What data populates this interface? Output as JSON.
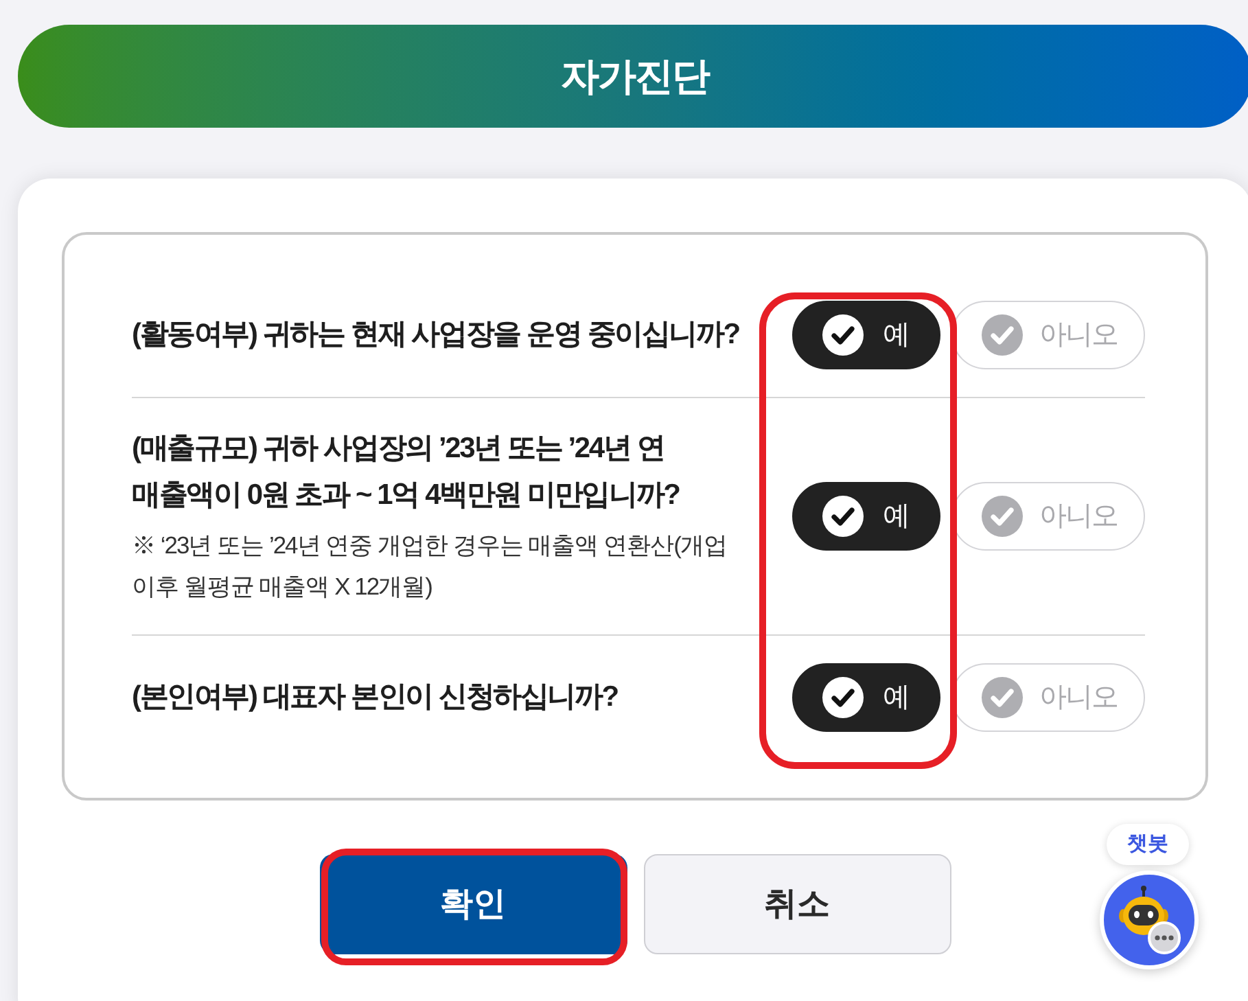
{
  "header": {
    "title": "자가진단"
  },
  "questions_panel": {
    "first_answers_highlighted": true,
    "questions": [
      {
        "question": "(활동여부) 귀하는 현재 사업장을 운영 중이십니까?",
        "answers": [
          {
            "label": "예",
            "selected": true
          },
          {
            "label": "아니오",
            "selected": false
          }
        ]
      },
      {
        "question": "(매출규모) 귀하 사업장의 ’23년 또는 ’24년 연 매출액이 0원 초과 ~ 1억 4백만원 미만입니까?",
        "note": "※ ‘23년 또는 ’24년 연중 개업한 경우는 매출액 연환산(개업 이후 월평균 매출액 X 12개월)",
        "answers": [
          {
            "label": "예",
            "selected": true
          },
          {
            "label": "아니오",
            "selected": false
          }
        ]
      },
      {
        "question": "(본인여부) 대표자 본인이 신청하십니까?",
        "answers": [
          {
            "label": "예",
            "selected": true
          },
          {
            "label": "아니오",
            "selected": false
          }
        ]
      }
    ]
  },
  "buttons": [
    {
      "label": "확인",
      "kind": "primary",
      "highlighted": true
    },
    {
      "label": "취소",
      "kind": "secondary",
      "highlighted": false
    }
  ],
  "chatbot": {
    "label": "챗봇"
  }
}
